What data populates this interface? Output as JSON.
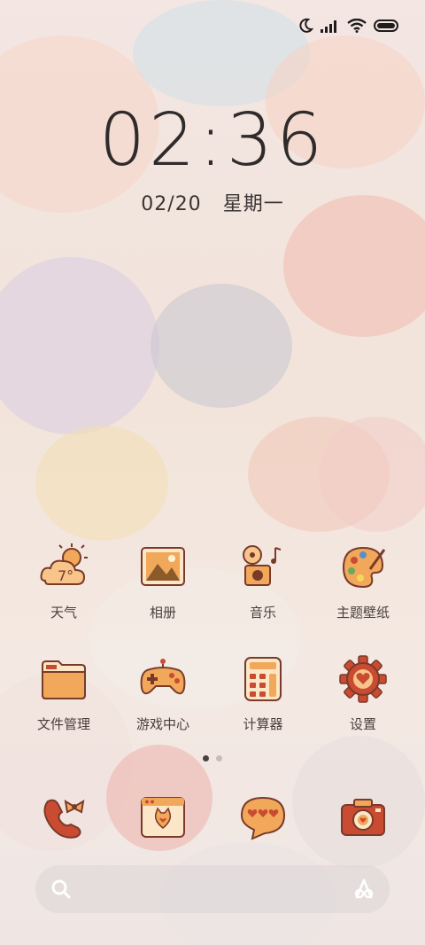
{
  "clock": {
    "time": "02:36"
  },
  "date": {
    "date_text": "02/20",
    "weekday": "星期一"
  },
  "status_bar": {
    "icons": [
      "moon-icon",
      "signal-icon",
      "wifi-icon",
      "battery-icon"
    ]
  },
  "apps_row1": [
    {
      "label": "天气",
      "icon": "weather-icon",
      "temp": "7°"
    },
    {
      "label": "相册",
      "icon": "gallery-icon"
    },
    {
      "label": "音乐",
      "icon": "music-icon"
    },
    {
      "label": "主题壁纸",
      "icon": "theme-palette-icon"
    }
  ],
  "apps_row2": [
    {
      "label": "文件管理",
      "icon": "folder-icon"
    },
    {
      "label": "游戏中心",
      "icon": "gamepad-icon"
    },
    {
      "label": "计算器",
      "icon": "calculator-icon"
    },
    {
      "label": "设置",
      "icon": "gear-heart-icon"
    }
  ],
  "pager": {
    "pages": 2,
    "active": 1
  },
  "dock_apps": [
    {
      "icon": "phone-bow-icon"
    },
    {
      "icon": "browser-cat-icon"
    },
    {
      "icon": "message-hearts-icon"
    },
    {
      "icon": "camera-icon"
    }
  ],
  "search_bar": {
    "left_icon": "search-icon",
    "right_icon": "ai-assistant-icon"
  },
  "colors": {
    "icon_orange": "#f2a85a",
    "icon_red": "#c94b32",
    "icon_outline": "#7a3a2a",
    "clock": "#2f2b2b"
  }
}
